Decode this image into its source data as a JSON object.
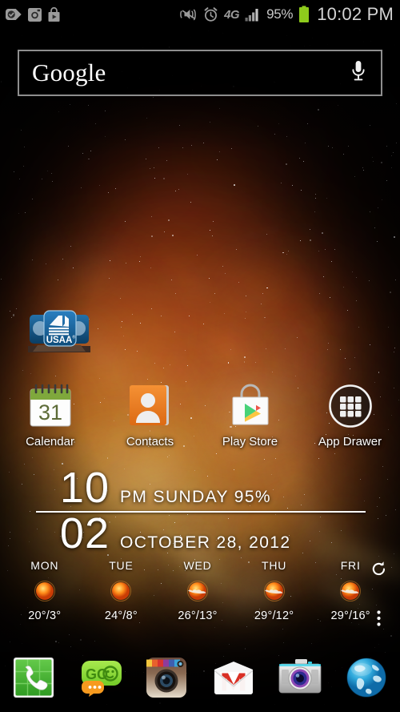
{
  "statusbar": {
    "left_icons": [
      {
        "name": "tag-check-icon",
        "label": "Notification"
      },
      {
        "name": "instagram-icon",
        "label": "Instagram"
      },
      {
        "name": "play-store-bag-icon",
        "label": "Play Store"
      }
    ],
    "right_icons": [
      {
        "name": "vibrate-mute-icon",
        "label": "Silent / vibrate"
      },
      {
        "name": "alarm-clock-icon",
        "label": "Alarm set"
      },
      {
        "name": "network-4g-icon",
        "label": "4G"
      },
      {
        "name": "signal-bars-icon",
        "label": "Signal"
      }
    ],
    "network_label": "4G",
    "battery_percent": "95%",
    "battery_color": "#8ecb1c",
    "clock": "10:02 PM"
  },
  "search": {
    "logo_text": "Google",
    "mic_icon": "microphone-icon",
    "border_color": "#8e8e8e"
  },
  "folder": {
    "name": "USAA",
    "label": "USAA",
    "registered_mark": "®",
    "color": "#1e6fa8"
  },
  "apps": [
    {
      "name": "calendar",
      "label": "Calendar",
      "icon": "calendar-icon",
      "date_number": "31"
    },
    {
      "name": "contacts",
      "label": "Contacts",
      "icon": "contacts-icon"
    },
    {
      "name": "play-store",
      "label": "Play Store",
      "icon": "play-store-icon"
    },
    {
      "name": "app-drawer",
      "label": "App Drawer",
      "icon": "app-drawer-icon"
    }
  ],
  "clock_widget": {
    "hour": "10",
    "minute": "02",
    "meridiem": "PM",
    "weekday": "SUNDAY",
    "battery": "95%",
    "meta_top": "PM  SUNDAY  95%",
    "date": "OCTOBER 28, 2012"
  },
  "weather": {
    "refresh_icon": "refresh-icon",
    "menu_icon": "overflow-menu-icon",
    "days": [
      {
        "day": "MON",
        "icon": "sunny-icon",
        "high": "20°",
        "low": "3°",
        "temps": "20°/3°"
      },
      {
        "day": "TUE",
        "icon": "sunny-icon",
        "high": "24°",
        "low": "8°",
        "temps": "24°/8°"
      },
      {
        "day": "WED",
        "icon": "partly-cloudy-icon",
        "high": "26°",
        "low": "13°",
        "temps": "26°/13°"
      },
      {
        "day": "THU",
        "icon": "partly-cloudy-icon",
        "high": "29°",
        "low": "12°",
        "temps": "29°/12°"
      },
      {
        "day": "FRI",
        "icon": "partly-cloudy-icon",
        "high": "29°",
        "low": "16°",
        "temps": "29°/16°"
      }
    ]
  },
  "dock": [
    {
      "name": "phone",
      "label": "Phone",
      "icon": "phone-icon"
    },
    {
      "name": "go-sms",
      "label": "GO SMS Pro",
      "icon": "go-sms-icon",
      "badge_text": "GO"
    },
    {
      "name": "instagram",
      "label": "Instagram",
      "icon": "instagram-icon"
    },
    {
      "name": "gmail",
      "label": "Gmail",
      "icon": "gmail-icon"
    },
    {
      "name": "camera",
      "label": "Camera",
      "icon": "camera-icon"
    },
    {
      "name": "browser",
      "label": "Browser",
      "icon": "browser-globe-icon"
    }
  ]
}
